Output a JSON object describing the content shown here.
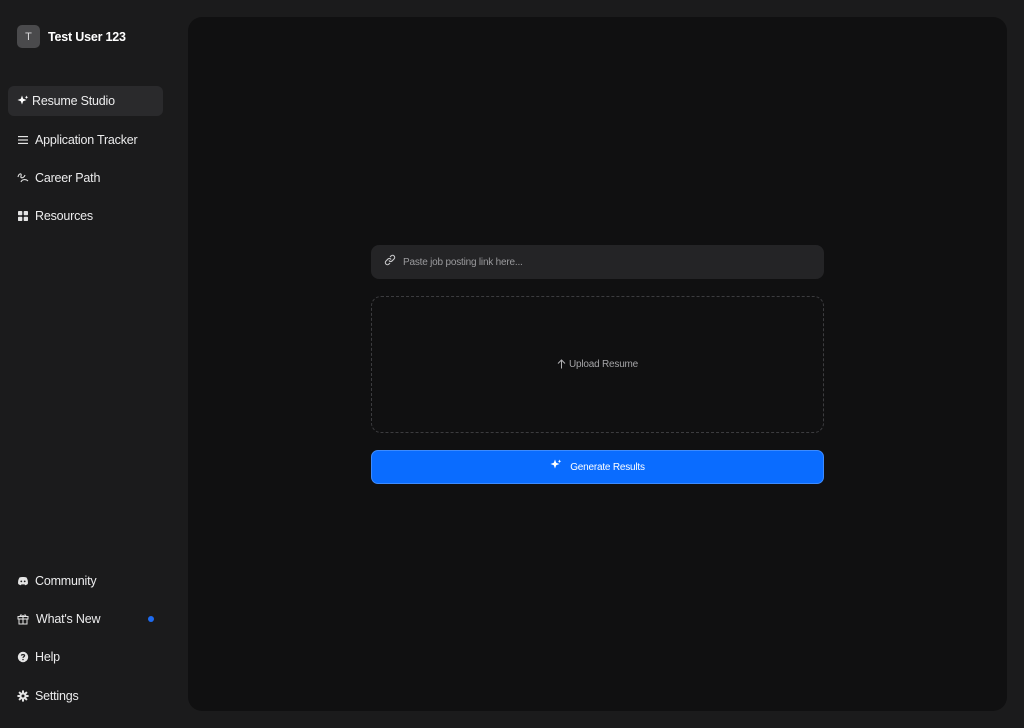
{
  "user": {
    "initial": "T",
    "name": "Test User 123"
  },
  "nav": {
    "items": [
      {
        "label": "Resume Studio",
        "icon": "sparkle-icon",
        "active": true
      },
      {
        "label": "Application Tracker",
        "icon": "list-icon"
      },
      {
        "label": "Career Path",
        "icon": "path-icon"
      },
      {
        "label": "Resources",
        "icon": "grid-icon"
      }
    ],
    "bottom": [
      {
        "label": "Community",
        "icon": "discord-icon"
      },
      {
        "label": "What's New",
        "icon": "gift-icon",
        "has_dot": true
      },
      {
        "label": "Help",
        "icon": "help-icon"
      },
      {
        "label": "Settings",
        "icon": "gear-icon"
      }
    ]
  },
  "main": {
    "link_input": {
      "placeholder": "Paste job posting link here...",
      "value": ""
    },
    "upload": {
      "label": "Upload Resume",
      "icon": "arrow-up-icon"
    },
    "generate": {
      "label": "Generate Results",
      "icon": "sparkle-icon"
    }
  },
  "colors": {
    "accent": "#0a6cff",
    "background": "#1b1b1c",
    "panel": "#101011",
    "notification_dot": "#1e6bf0"
  }
}
